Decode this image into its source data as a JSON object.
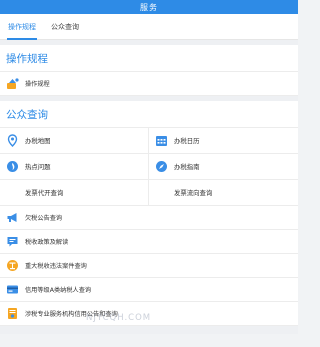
{
  "header": {
    "title": "服务"
  },
  "tabs": [
    {
      "label": "操作规程"
    },
    {
      "label": "公众查询"
    }
  ],
  "section_rules": {
    "title": "操作规程",
    "items": [
      {
        "label": "操作规程",
        "icon": "operation-guide-icon"
      }
    ]
  },
  "section_query": {
    "title": "公众查询",
    "grid": [
      {
        "label": "办税地图",
        "icon": "location-pin-icon"
      },
      {
        "label": "办税日历",
        "icon": "calendar-icon"
      },
      {
        "label": "热点问题",
        "icon": "hot-issue-icon"
      },
      {
        "label": "办税指南",
        "icon": "compass-icon"
      },
      {
        "label": "发票代开查询",
        "icon": ""
      },
      {
        "label": "发票流向查询",
        "icon": ""
      }
    ],
    "list": [
      {
        "label": "欠税公告查询",
        "icon": "megaphone-icon"
      },
      {
        "label": "税收政策及解读",
        "icon": "speech-bubble-icon"
      },
      {
        "label": "重大税收违法案件查询",
        "icon": "law-icon"
      },
      {
        "label": "信用等级A类纳税人查询",
        "icon": "credit-card-icon"
      },
      {
        "label": "涉税专业服务机构信用公告和查询",
        "icon": "certificate-icon"
      }
    ]
  },
  "watermark": "NJYCQH.COM",
  "colors": {
    "accent": "#2e8be6",
    "icon_orange": "#f5a623",
    "icon_blue": "#3a8ee6"
  }
}
